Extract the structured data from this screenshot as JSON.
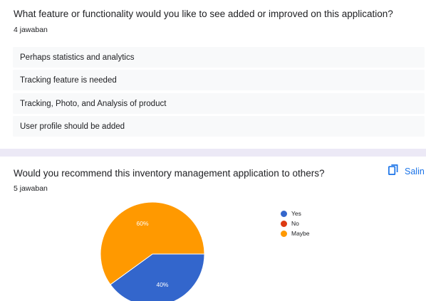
{
  "question1": {
    "title": "What feature or functionality would you like to see added or improved on this application?",
    "count": "4 jawaban",
    "answers": [
      "Perhaps statistics and analytics",
      "Tracking feature is needed",
      "Tracking, Photo, and Analysis of product",
      "User profile should be added"
    ]
  },
  "question2": {
    "title": "Would you recommend this inventory management application to others?",
    "count": "5 jawaban",
    "copy_label": "Salin",
    "copy_icon": "copy-icon"
  },
  "chart_data": {
    "type": "pie",
    "labels": [
      "Yes",
      "No",
      "Maybe"
    ],
    "values": [
      40,
      0,
      60
    ],
    "colors": [
      "#3366cc",
      "#dc3912",
      "#ff9900"
    ],
    "data_labels": [
      "40%",
      "",
      "60%"
    ],
    "legend_position": "right"
  }
}
